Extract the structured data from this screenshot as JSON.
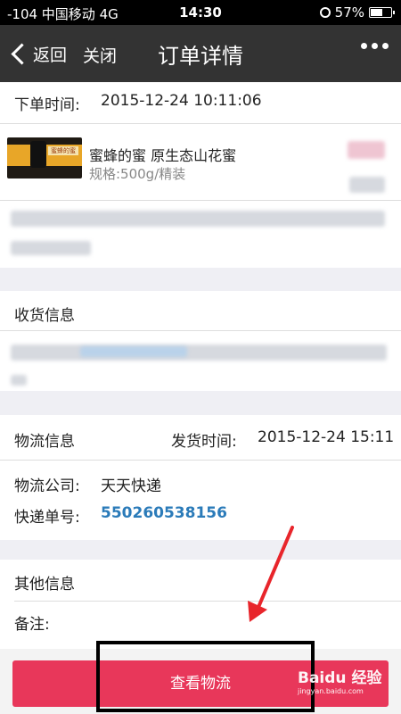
{
  "status_bar": {
    "carrier": "-104 中国移动 4G",
    "time": "14:30",
    "battery": "57%"
  },
  "nav": {
    "back_label": "返回",
    "close_label": "关闭",
    "title": "订单详情"
  },
  "order": {
    "time_label": "下单时间:",
    "time_value": "2015-12-24 10:11:06",
    "product_name": "蜜蜂的蜜 原生态山花蜜",
    "product_spec": "规格:500g/精装",
    "product_image_label": "蜜蜂的蜜"
  },
  "shipping": {
    "title": "收货信息"
  },
  "logistics": {
    "title": "物流信息",
    "ship_time_label": "发货时间:",
    "ship_time_value": "2015-12-24 15:11",
    "company_label": "物流公司:",
    "company_value": "天天快递",
    "tracking_label": "快递单号:",
    "tracking_value": "550260538156"
  },
  "other": {
    "title": "其他信息",
    "remark_label": "备注:"
  },
  "actions": {
    "view_logistics": "查看物流"
  },
  "watermark": {
    "brand": "Baidu 经验",
    "url": "jingyan.baidu.com"
  },
  "colors": {
    "primary_button": "#e8375a",
    "link": "#2b7bb9",
    "annotation_arrow": "#e8252b"
  }
}
